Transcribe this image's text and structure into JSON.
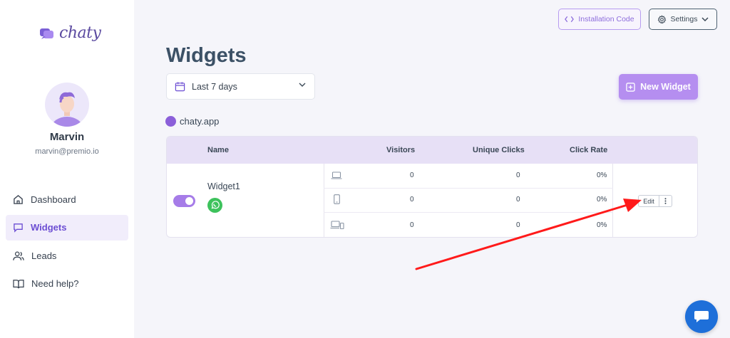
{
  "brand": {
    "name": "chaty"
  },
  "user": {
    "name": "Marvin",
    "email": "marvin@premio.io"
  },
  "nav": [
    {
      "label": "Dashboard",
      "icon": "home-icon"
    },
    {
      "label": "Widgets",
      "icon": "chat-bubble-icon",
      "active": true
    },
    {
      "label": "Leads",
      "icon": "users-icon"
    },
    {
      "label": "Need help?",
      "icon": "book-icon"
    }
  ],
  "header": {
    "install_label": "Installation Code",
    "settings_label": "Settings",
    "title": "Widgets",
    "date_range": "Last 7 days",
    "new_widget_label": "New Widget"
  },
  "site": {
    "domain": "chaty.app"
  },
  "table": {
    "columns": {
      "name": "Name",
      "visitors": "Visitors",
      "unique_clicks": "Unique Clicks",
      "click_rate": "Click Rate"
    },
    "widget": {
      "name": "Widget1",
      "enabled": true,
      "channel_icon": "whatsapp-icon",
      "rows": [
        {
          "device": "desktop-icon",
          "visitors": "0",
          "unique_clicks": "0",
          "click_rate": "0%"
        },
        {
          "device": "mobile-icon",
          "visitors": "0",
          "unique_clicks": "0",
          "click_rate": "0%"
        },
        {
          "device": "all-devices-icon",
          "visitors": "0",
          "unique_clicks": "0",
          "click_rate": "0%"
        }
      ],
      "edit_label": "Edit"
    }
  },
  "colors": {
    "accent": "#b58ef0",
    "arrow": "#ff1a1a",
    "chat_fab": "#1e6fd9"
  }
}
